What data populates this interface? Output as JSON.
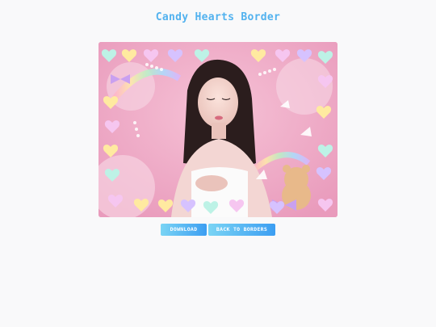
{
  "page": {
    "title": "Candy Hearts Border"
  },
  "preview": {
    "description_icon": "photo-with-candy-hearts-border"
  },
  "buttons": {
    "download_label": "DOWNLOAD",
    "back_label": "BACK TO BORDERS"
  },
  "colors": {
    "title": "#52b2ef",
    "button_start": "#7ad4f4",
    "button_end": "#3c9ef2",
    "background": "#f9f9fa"
  }
}
